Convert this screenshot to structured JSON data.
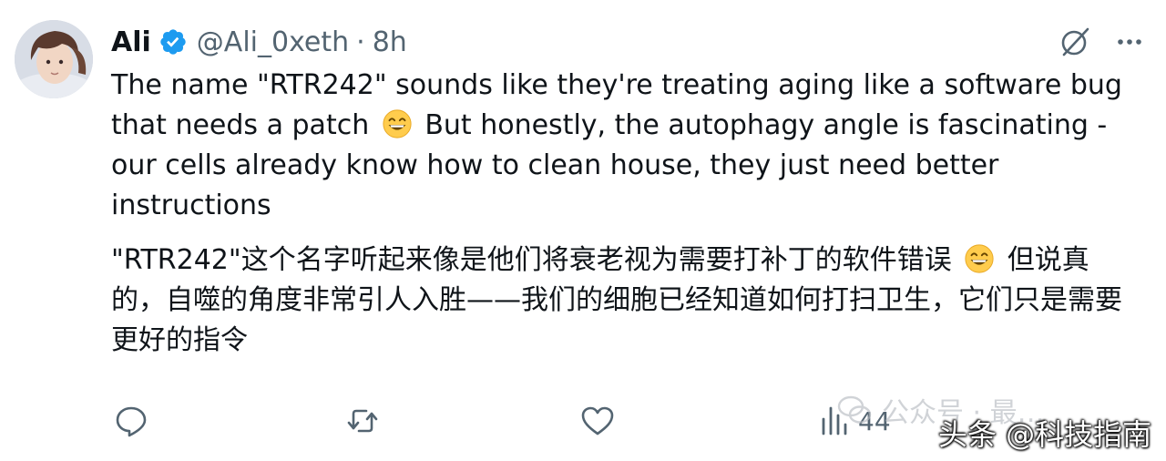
{
  "tweet": {
    "author_name": "Ali",
    "handle": "@Ali_0xeth",
    "separator": "·",
    "time": "8h",
    "text_en_1": "The name \"RTR242\" sounds like they're treating aging like a software bug that needs a patch",
    "text_en_2": "But honestly, the autophagy angle is fascinating - our cells already know how to clean house, they just need better instructions",
    "text_zh_1": "\"RTR242\"这个名字听起来像是他们将衰老视为需要打补丁的软件错误",
    "text_zh_2": "但说真的，自噬的角度非常引人入胜——我们的细胞已经知道如何打扫卫生，它们只是需要更好的指令",
    "emoji": "grinning-squinting-face"
  },
  "actions": {
    "views_count": "44"
  },
  "watermark": {
    "faint_text": "公众号 · 最…",
    "main_text": "头条 @科技指南"
  },
  "colors": {
    "text": "#0f1419",
    "secondary": "#536471",
    "verified_blue": "#1d9bf0"
  }
}
